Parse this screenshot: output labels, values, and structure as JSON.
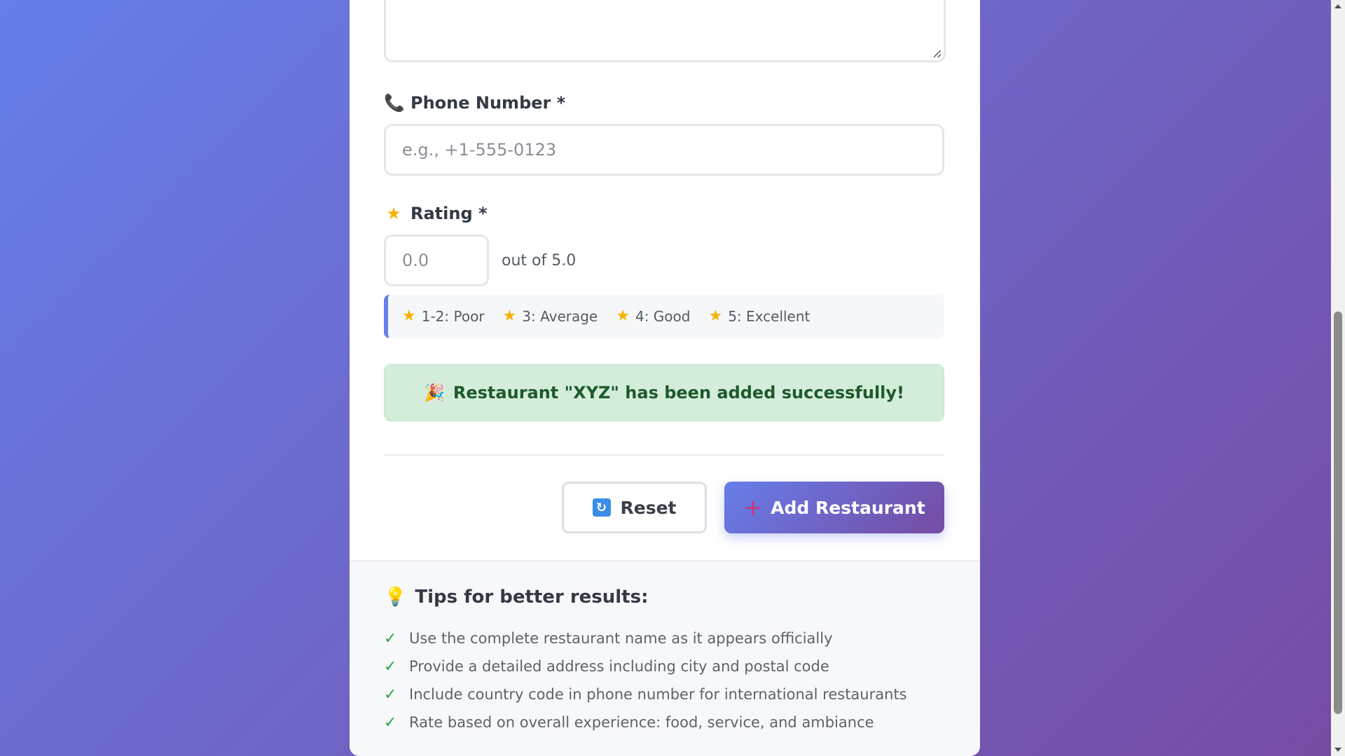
{
  "form": {
    "address_value": "",
    "phone": {
      "icon": "phone-icon",
      "label": "Phone Number *",
      "placeholder": "e.g., +1-555-0123",
      "value": ""
    },
    "rating": {
      "icon": "star-icon",
      "label": "Rating *",
      "placeholder": "0.0",
      "value": "",
      "suffix": "out of 5.0",
      "legend": [
        {
          "icon": "star-icon",
          "label": "1-2: Poor"
        },
        {
          "icon": "star-icon",
          "label": "3: Average"
        },
        {
          "icon": "star-icon",
          "label": "4: Good"
        },
        {
          "icon": "star-icon",
          "label": "5: Excellent"
        }
      ]
    },
    "success_message": {
      "icon": "party-popper-icon",
      "text": "Restaurant \"XYZ\" has been added successfully!"
    },
    "actions": {
      "reset_icon": "refresh-icon",
      "reset_label": "Reset",
      "add_icon": "plus-icon",
      "add_label": "Add Restaurant"
    }
  },
  "tips": {
    "icon": "lightbulb-icon",
    "title": "Tips for better results:",
    "items": [
      "Use the complete restaurant name as it appears officially",
      "Provide a detailed address including city and postal code",
      "Include country code in phone number for international restaurants",
      "Rate based on overall experience: food, service, and ambiance"
    ]
  },
  "colors": {
    "gradient_start": "#667eea",
    "gradient_end": "#764ba2",
    "success_bg": "#d4edda",
    "success_text": "#1e5a2c",
    "check_green": "#28a745",
    "star_gold": "#f5b400"
  }
}
